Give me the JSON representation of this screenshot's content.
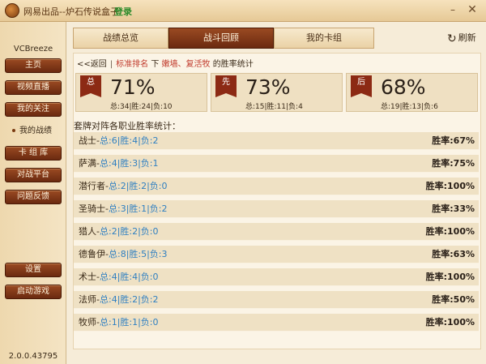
{
  "window": {
    "title": "网易出品--炉石传说盒子",
    "login": "登录",
    "minimize": "–",
    "close": "✕"
  },
  "sidebar": {
    "brand": "VCBreeze",
    "items": [
      {
        "label": "主页"
      },
      {
        "label": "视频直播"
      },
      {
        "label": "我的关注"
      },
      {
        "label": "我的战绩"
      },
      {
        "label": "卡 组 库"
      },
      {
        "label": "对战平台"
      },
      {
        "label": "问题反馈"
      }
    ],
    "settings": "设置",
    "launch": "启动游戏",
    "version": "2.0.0.43795"
  },
  "tabs": [
    {
      "label": "战绩总览"
    },
    {
      "label": "战斗回顾"
    },
    {
      "label": "我的卡组"
    }
  ],
  "refresh": "刷新",
  "breadcrumb": {
    "back": "<<返回",
    "separator": "|",
    "mode": "标准排名",
    "under": "下",
    "deck": "嫩墙、复活牧",
    "suffix": "的胜率统计"
  },
  "stats": [
    {
      "tag": "总",
      "pct": "71%",
      "summary": "总:34|胜:24|负:10"
    },
    {
      "tag": "先",
      "pct": "73%",
      "summary": "总:15|胜:11|负:4"
    },
    {
      "tag": "后",
      "pct": "68%",
      "summary": "总:19|胜:13|负:6"
    }
  ],
  "section_title": "套牌对阵各职业胜率统计：",
  "rows": [
    {
      "cls": "战士-",
      "detail": "总:6|胜:4|负:2",
      "rate": "胜率:67%"
    },
    {
      "cls": "萨满-",
      "detail": "总:4|胜:3|负:1",
      "rate": "胜率:75%"
    },
    {
      "cls": "潜行者-",
      "detail": "总:2|胜:2|负:0",
      "rate": "胜率:100%"
    },
    {
      "cls": "圣骑士-",
      "detail": "总:3|胜:1|负:2",
      "rate": "胜率:33%"
    },
    {
      "cls": "猎人-",
      "detail": "总:2|胜:2|负:0",
      "rate": "胜率:100%"
    },
    {
      "cls": "德鲁伊-",
      "detail": "总:8|胜:5|负:3",
      "rate": "胜率:63%"
    },
    {
      "cls": "术士-",
      "detail": "总:4|胜:4|负:0",
      "rate": "胜率:100%"
    },
    {
      "cls": "法师-",
      "detail": "总:4|胜:2|负:2",
      "rate": "胜率:50%"
    },
    {
      "cls": "牧师-",
      "detail": "总:1|胜:1|负:0",
      "rate": "胜率:100%"
    }
  ]
}
